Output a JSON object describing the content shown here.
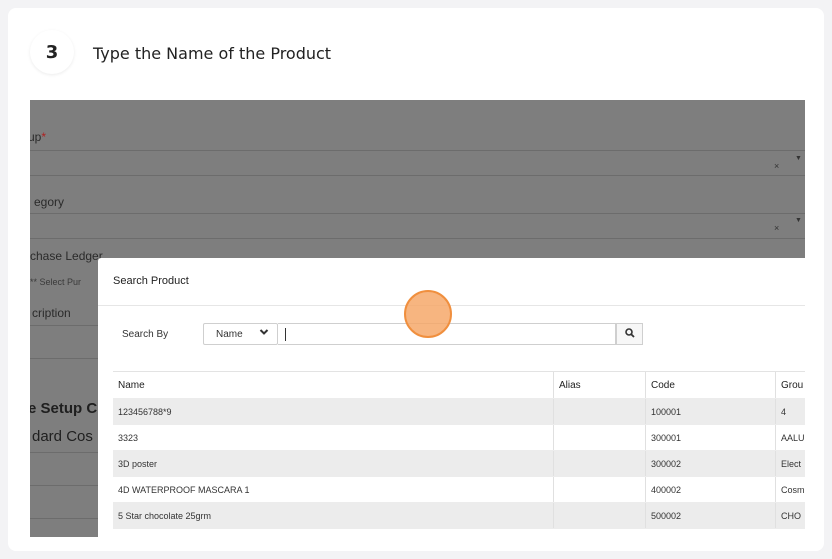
{
  "step": {
    "number": "3",
    "title": "Type the Name of the Product"
  },
  "background_form": {
    "group_label": "up",
    "group_required_mark": "*",
    "category_label": "egory",
    "purchase_ledger_label": "chase Ledger",
    "purchase_ledger_placeholder": "** Select Pur",
    "description_label": "cription",
    "setup_heading": "e Setup C",
    "standard_cost_label": "dard Cos",
    "clear_symbol": "×",
    "caret_symbol": "▼"
  },
  "modal": {
    "title": "Search Product",
    "search_by_label": "Search By",
    "search_by_selected": "Name",
    "search_input_value": "",
    "columns": [
      "Name",
      "Alias",
      "Code",
      "Grou"
    ],
    "rows": [
      {
        "name": "123456788*9",
        "alias": "",
        "code": "100001",
        "group": "4"
      },
      {
        "name": "3323",
        "alias": "",
        "code": "300001",
        "group": "AALU"
      },
      {
        "name": "3D poster",
        "alias": "",
        "code": "300002",
        "group": "Elect"
      },
      {
        "name": "4D WATERPROOF MASCARA 1",
        "alias": "",
        "code": "400002",
        "group": "Cosm"
      },
      {
        "name": "5 Star chocolate 25grm",
        "alias": "",
        "code": "500002",
        "group": "CHO"
      }
    ]
  },
  "icons": {
    "search_button": "search-icon",
    "select_chevron": "chevron-down-icon"
  },
  "colors": {
    "click_highlight": "#f08f3e",
    "overlay": "#7e7e7e"
  }
}
